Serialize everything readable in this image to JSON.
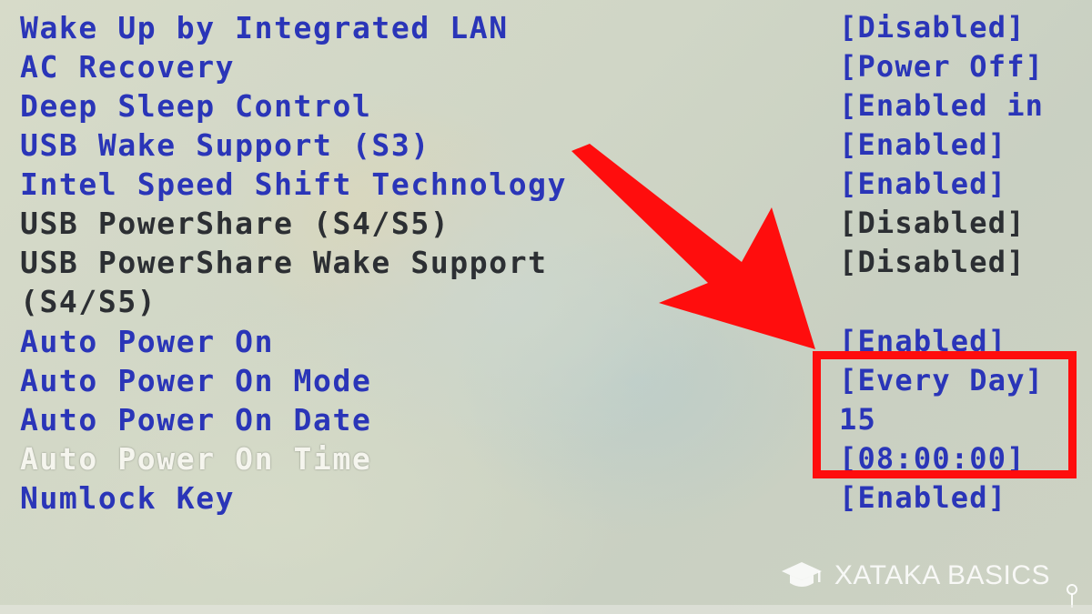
{
  "settings": [
    {
      "label": "Wake Up by Integrated LAN",
      "value": "[Disabled]",
      "label_color": "blue",
      "value_color": "blue"
    },
    {
      "label": "AC Recovery",
      "value": "[Power Off]",
      "label_color": "blue",
      "value_color": "blue"
    },
    {
      "label": "Deep Sleep Control",
      "value": "[Enabled in",
      "label_color": "blue",
      "value_color": "blue"
    },
    {
      "label": "USB Wake Support (S3)",
      "value": "[Enabled]",
      "label_color": "blue",
      "value_color": "blue"
    },
    {
      "label": "Intel Speed Shift Technology",
      "value": "[Enabled]",
      "label_color": "blue",
      "value_color": "blue"
    },
    {
      "label": "USB PowerShare (S4/S5)",
      "value": "[Disabled]",
      "label_color": "dark",
      "value_color": "dark"
    },
    {
      "label": "USB PowerShare Wake Support",
      "value": "[Disabled]",
      "label_color": "dark",
      "value_color": "dark"
    },
    {
      "label": "(S4/S5)",
      "value": "",
      "label_color": "dark",
      "value_color": "dark"
    },
    {
      "label": "Auto Power On",
      "value": "[Enabled]",
      "label_color": "blue",
      "value_color": "blue"
    },
    {
      "label": "Auto Power On Mode",
      "value": "[Every Day]",
      "label_color": "blue",
      "value_color": "blue"
    },
    {
      "label": "Auto Power On Date",
      "value": "15",
      "label_color": "blue",
      "value_color": "blue"
    },
    {
      "label": "Auto Power On Time",
      "value": "[08:00:00]",
      "label_color": "white",
      "value_color": "blue"
    },
    {
      "label": "Numlock Key",
      "value": "[Enabled]",
      "label_color": "blue",
      "value_color": "blue"
    }
  ],
  "watermark": {
    "text": "XATAKA BASICS",
    "icon": "graduation-cap-icon"
  },
  "colors": {
    "setting_blue": "#2a35b8",
    "setting_dark": "#2c2f33",
    "selected_white": "#f5f5ee",
    "annotation_red": "#ff0d0d"
  },
  "annotation": {
    "arrow_icon": "red-arrow-icon",
    "box": "red-highlight-box"
  }
}
